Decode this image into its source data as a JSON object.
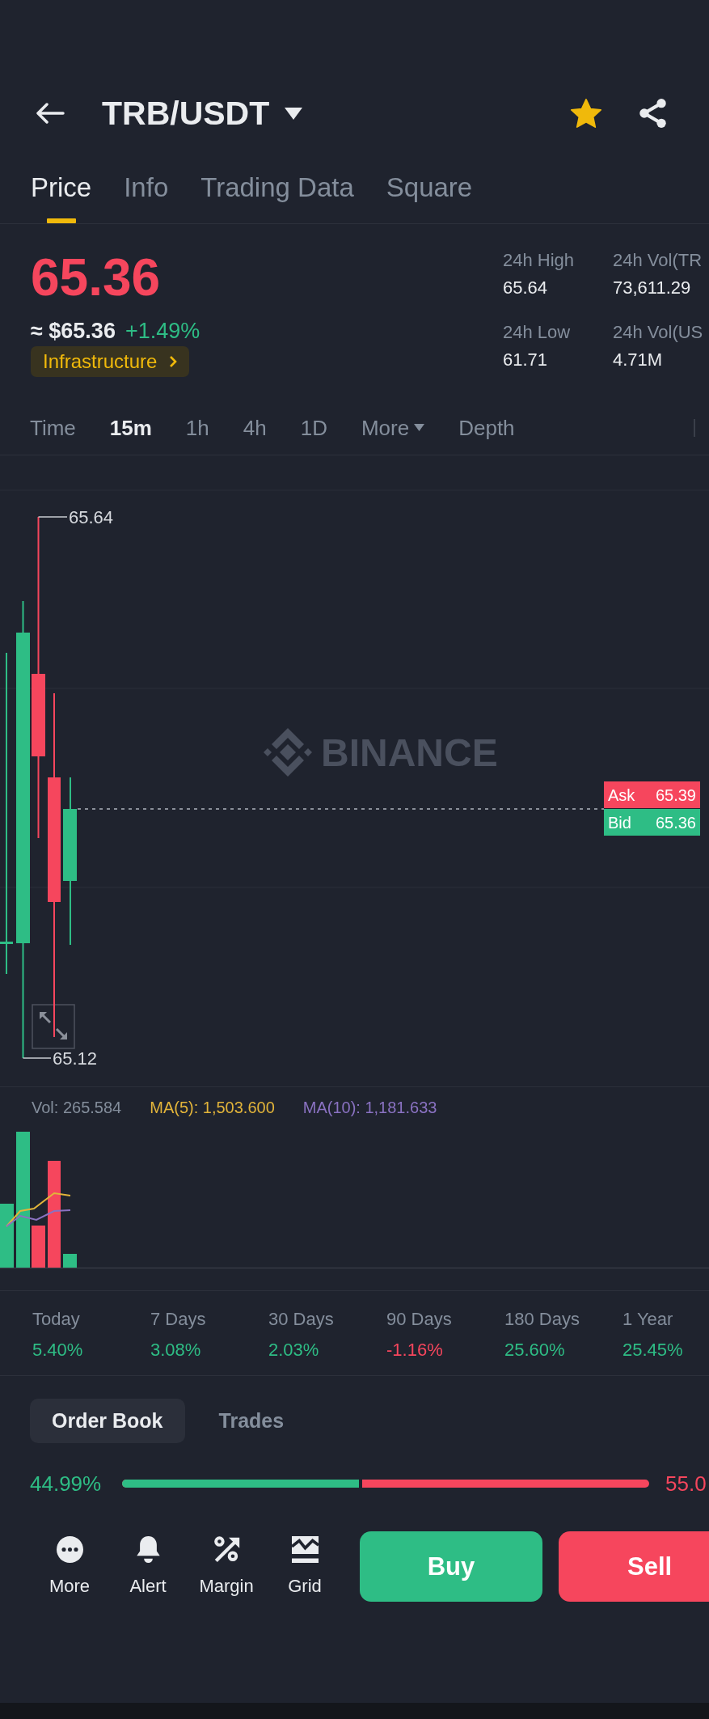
{
  "header": {
    "title": "TRB/USDT",
    "favorite": true
  },
  "tabs": [
    {
      "label": "Price",
      "selected": true
    },
    {
      "label": "Info",
      "selected": false
    },
    {
      "label": "Trading Data",
      "selected": false
    },
    {
      "label": "Square",
      "selected": false
    }
  ],
  "ticker": {
    "last_price": "65.36",
    "last_price_rising": false,
    "fiat_price": "≈ $65.36",
    "change": "+1.49%",
    "change_rising": true,
    "category": "Infrastructure"
  },
  "stats": [
    {
      "label": "24h High",
      "value": "65.64"
    },
    {
      "label": "24h Vol(TR",
      "value": "73,611.29"
    },
    {
      "label": "24h Low",
      "value": "61.71"
    },
    {
      "label": "24h Vol(US",
      "value": "4.71M"
    }
  ],
  "intervals": [
    {
      "label": "Time",
      "selected": false,
      "kind": "plain"
    },
    {
      "label": "15m",
      "selected": true,
      "kind": "plain"
    },
    {
      "label": "1h",
      "selected": false,
      "kind": "plain"
    },
    {
      "label": "4h",
      "selected": false,
      "kind": "plain"
    },
    {
      "label": "1D",
      "selected": false,
      "kind": "plain"
    },
    {
      "label": "More",
      "selected": false,
      "kind": "dropdown"
    },
    {
      "label": "Depth",
      "selected": false,
      "kind": "plain"
    }
  ],
  "chart": {
    "watermark": "BINANCE",
    "high_label": "65.64",
    "low_label": "65.12",
    "quotes": [
      {
        "label": "Ask",
        "value": "65.39",
        "kind": "ask"
      },
      {
        "label": "Bid",
        "value": "65.36",
        "kind": "bid"
      }
    ]
  },
  "volume_legend": [
    {
      "text": "Vol: 265.584",
      "color": "#848e9c"
    },
    {
      "text": "MA(5): 1,503.600",
      "color": "#e2b43a"
    },
    {
      "text": "MA(10): 1,181.633",
      "color": "#8a72c2"
    }
  ],
  "performance": [
    {
      "period": "Today",
      "change": "5.40%",
      "rising": true
    },
    {
      "period": "7 Days",
      "change": "3.08%",
      "rising": true
    },
    {
      "period": "30 Days",
      "change": "2.03%",
      "rising": true
    },
    {
      "period": "90 Days",
      "change": "-1.16%",
      "rising": false
    },
    {
      "period": "180 Days",
      "change": "25.60%",
      "rising": true
    },
    {
      "period": "1 Year",
      "change": "25.45%",
      "rising": true
    }
  ],
  "book_tabs": [
    {
      "label": "Order Book",
      "selected": true
    },
    {
      "label": "Trades",
      "selected": false
    }
  ],
  "depth_ratio": {
    "bid_share": "44.99%",
    "ask_share": "55.0",
    "level": 0.4499
  },
  "actions": [
    {
      "label": "More",
      "kind": "more"
    },
    {
      "label": "Alert",
      "kind": "alert"
    },
    {
      "label": "Margin",
      "kind": "margin"
    },
    {
      "label": "Grid",
      "kind": "grid"
    }
  ],
  "trade_buttons": [
    {
      "label": "Buy",
      "kind": "buy"
    },
    {
      "label": "Sell",
      "kind": "sell"
    }
  ]
}
